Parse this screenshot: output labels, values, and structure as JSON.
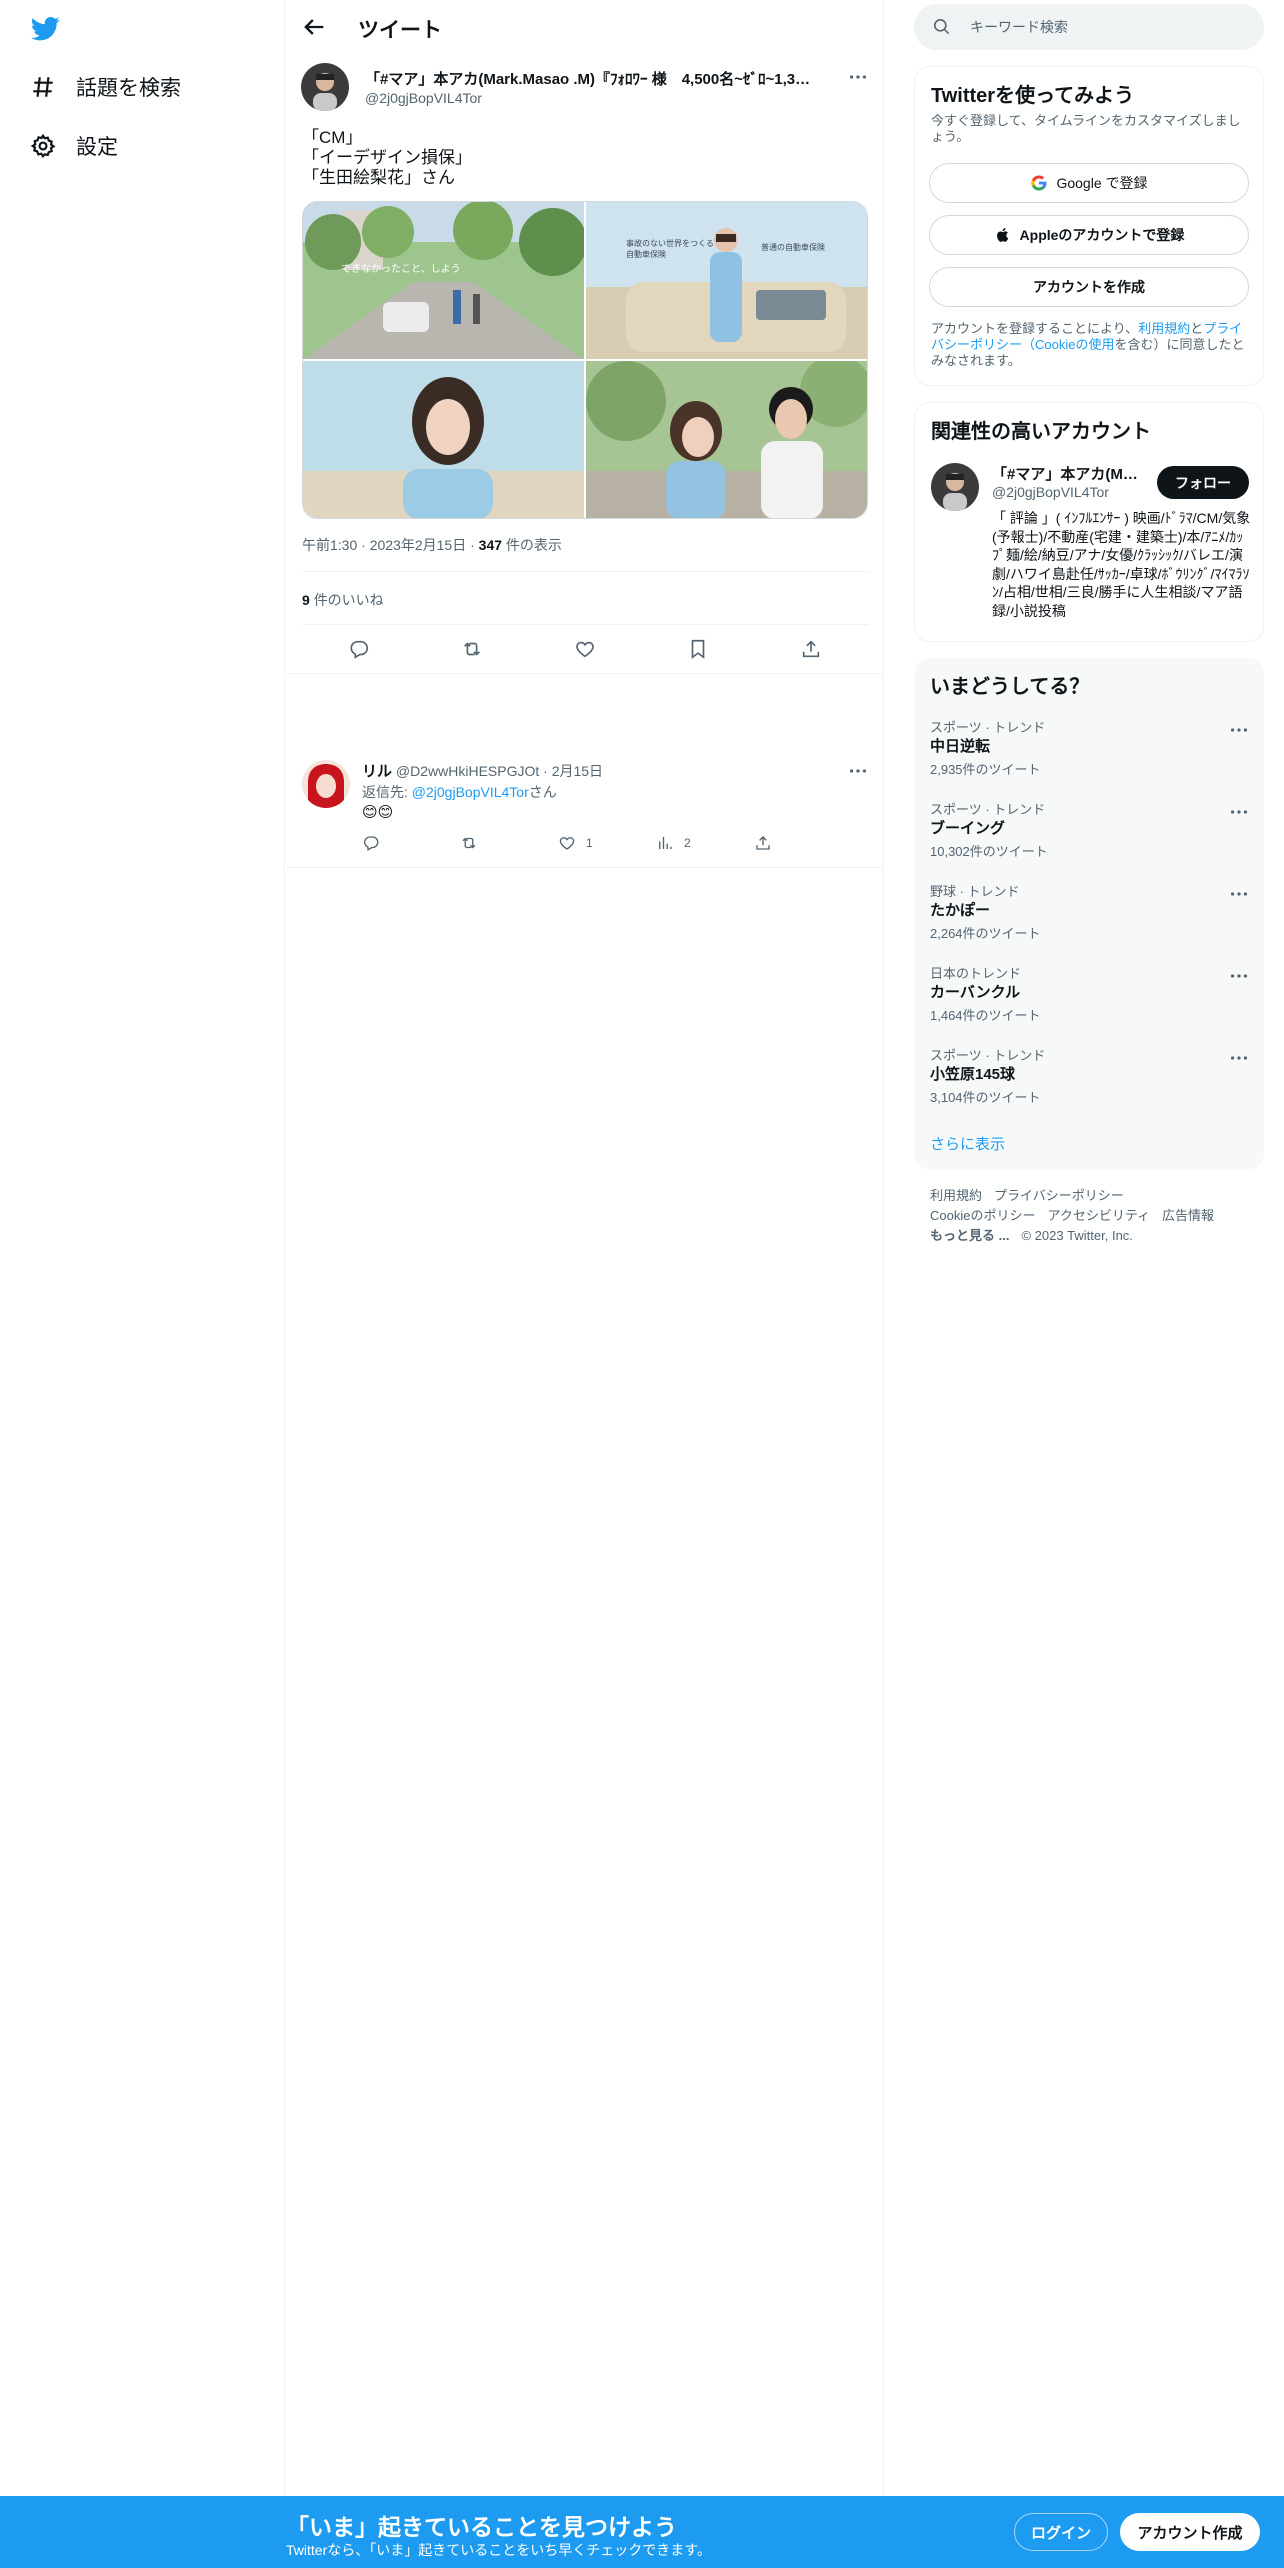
{
  "colors": {
    "accent": "#1d9bf0",
    "text": "#0f1419",
    "muted": "#536471",
    "border": "#eff3f4"
  },
  "nav": {
    "logo_icon": "twitter-bird-icon",
    "items": [
      {
        "icon": "hashtag-icon",
        "label": "話題を検索"
      },
      {
        "icon": "gear-icon",
        "label": "設定"
      }
    ]
  },
  "header": {
    "title": "ツイート"
  },
  "tweet": {
    "author_name": "「#マア」本アカ(Mark.Masao .M)『ﾌｫﾛﾜｰ 様　4,500名~ｾﾞﾛ~1,390...",
    "author_handle": "@2j0gjBopVIL4Tor",
    "text_lines": [
      "「CM」",
      "「イーデザイン損保」",
      "「生田絵梨花」さん"
    ],
    "media_captions": {
      "img1": "できなかったこと、しよう",
      "img2_left": "事故のない世界をつくる\n自動車保険",
      "img2_right": "普通の自動車保険"
    },
    "time": "午前1:30",
    "date": "2023年2月15日",
    "views_count": "347",
    "views_label": "件の表示",
    "likes_count": "9",
    "likes_label": "件のいいね"
  },
  "reply": {
    "name": "リル",
    "handle": "@D2wwHkiHESPGJOt",
    "date": "2月15日",
    "reply_to_label": "返信先: ",
    "reply_to_handle": "@2j0gjBopVIL4Tor",
    "reply_to_suffix": "さん",
    "body": "😊😊",
    "likes": "1",
    "views": "2"
  },
  "search": {
    "placeholder": "キーワード検索"
  },
  "signup": {
    "title": "Twitterを使ってみよう",
    "subtitle": "今すぐ登録して、タイムラインをカスタマイズしましょう。",
    "google_label": "Google で登録",
    "apple_label": "Appleのアカウントで登録",
    "create_label": "アカウントを作成",
    "legal_pre": "アカウントを登録することにより、",
    "legal_terms": "利用規約",
    "legal_and": "と",
    "legal_privacy": "プライバシーポリシー（Cookieの使用",
    "legal_post": "を含む）に同意したとみなされます。"
  },
  "related": {
    "title": "関連性の高いアカウント",
    "name": "「#マア」本アカ(Ma...",
    "handle": "@2j0gjBopVIL4Tor",
    "follow_label": "フォロー",
    "bio": "「 評論 」( ｲﾝﾌﾙｴﾝｻｰ ) 映画/ﾄﾞﾗﾏ/CM/気象(予報士)/不動産(宅建・建築士)/本/ｱﾆﾒ/ｶｯﾌﾟ麺/絵/納豆/アナ/女優/ｸﾗｯｼｯｸ/バレエ/演劇/ハワイ島赴任/ｻｯｶｰ/卓球/ﾎﾞｳﾘﾝｸﾞ/ﾏｲﾏﾗｿﾝ/占相/世相/三良/勝手に人生相談/マア語録/小説投稿"
  },
  "trends": {
    "title": "いまどうしてる？",
    "items": [
      {
        "category": "スポーツ · トレンド",
        "name": "中日逆転",
        "count": "2,935件のツイート"
      },
      {
        "category": "スポーツ · トレンド",
        "name": "ブーイング",
        "count": "10,302件のツイート"
      },
      {
        "category": "野球 · トレンド",
        "name": "たかぽー",
        "count": "2,264件のツイート"
      },
      {
        "category": "日本のトレンド",
        "name": "カーバンクル",
        "count": "1,464件のツイート"
      },
      {
        "category": "スポーツ · トレンド",
        "name": "小笠原145球",
        "count": "3,104件のツイート"
      }
    ],
    "show_more": "さらに表示"
  },
  "footer": {
    "terms": "利用規約",
    "privacy": "プライバシーポリシー",
    "cookies": "Cookieのポリシー",
    "accessibility": "アクセシビリティ",
    "ads": "広告情報",
    "more": "もっと見る ...",
    "copyright": "© 2023 Twitter, Inc."
  },
  "bottom_bar": {
    "title": "「いま」起きていることを見つけよう",
    "subtitle": "Twitterなら、「いま」起きていることをいち早くチェックできます。",
    "login_label": "ログイン",
    "signup_label": "アカウント作成"
  }
}
